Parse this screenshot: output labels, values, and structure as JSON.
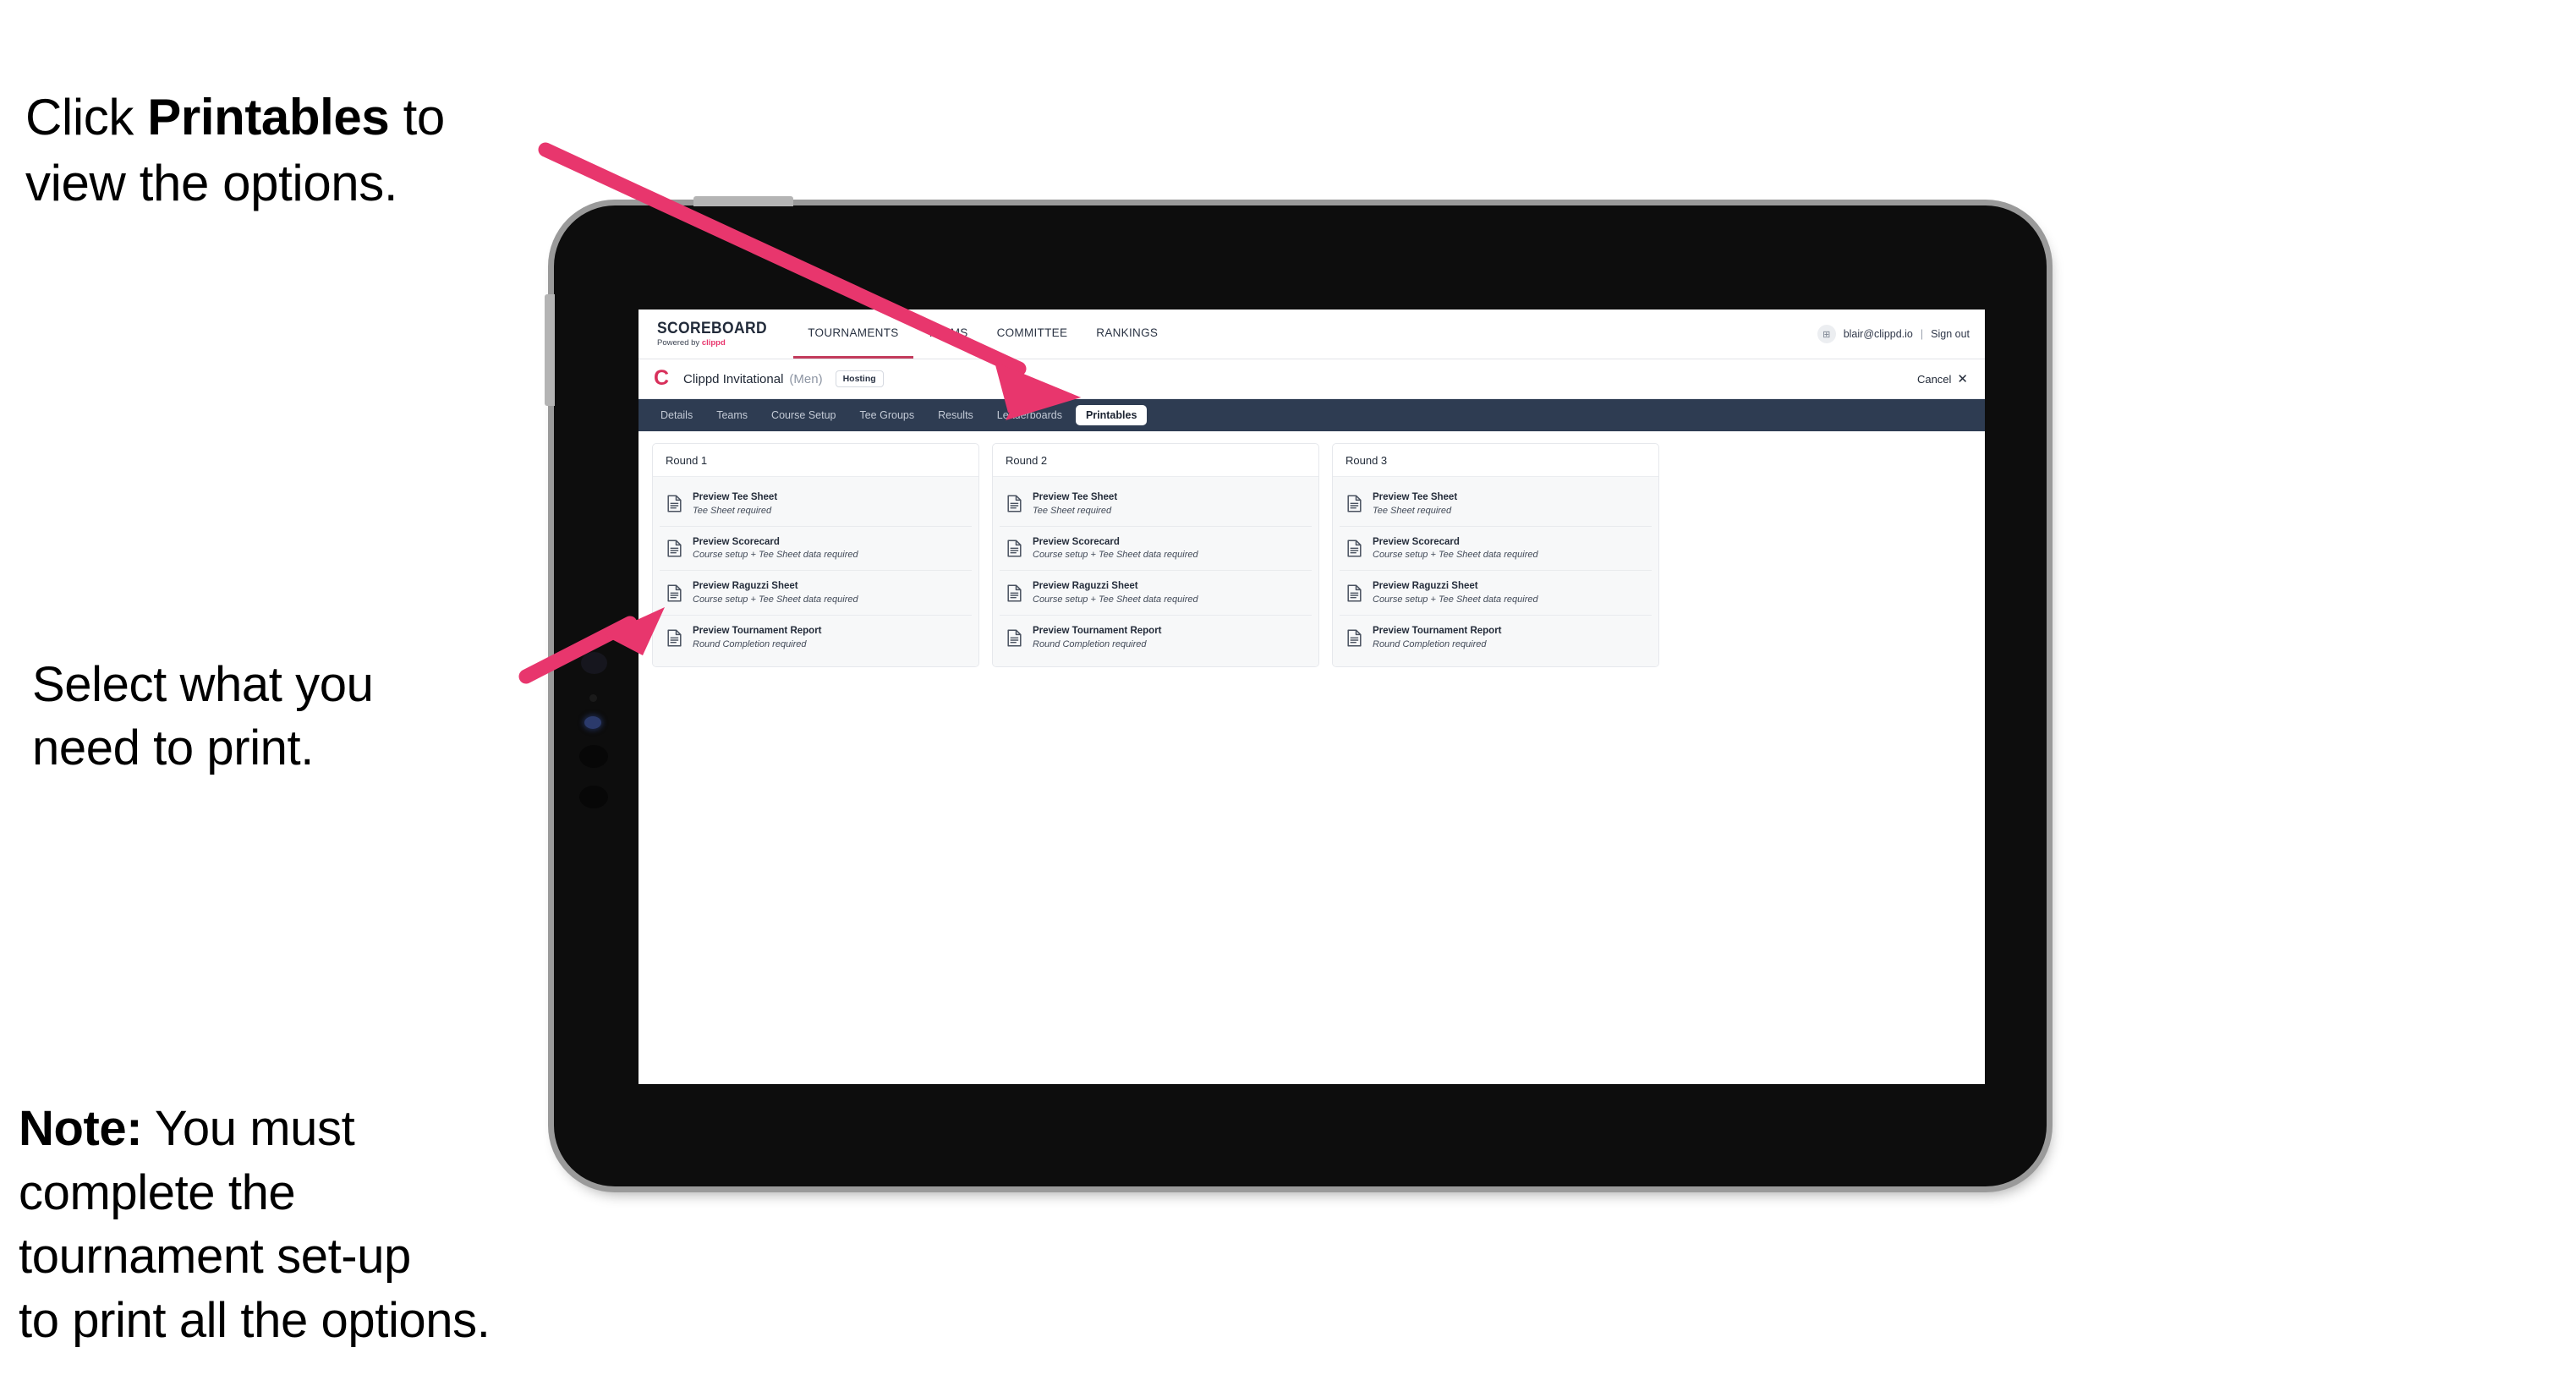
{
  "annotations": {
    "click_printables": "Click Printables to\nview the options.",
    "click_printables_pre": "Click ",
    "click_printables_bold": "Printables",
    "click_printables_post": " to\nview the options.",
    "select_print": "Select what you\n need to print.",
    "note_label": "Note:",
    "note_body": " You must\ncomplete the\ntournament set-up\nto print all the options.",
    "arrow_color": "#e8366d"
  },
  "app": {
    "brand": {
      "title": "SCOREBOARD",
      "powered_prefix": "Powered by ",
      "powered_brand": "clippd"
    },
    "topnav": [
      {
        "label": "TOURNAMENTS",
        "active": true
      },
      {
        "label": "TEAMS",
        "active": false
      },
      {
        "label": "COMMITTEE",
        "active": false
      },
      {
        "label": "RANKINGS",
        "active": false
      }
    ],
    "account": {
      "avatar_glyph": "⊞",
      "email": "blair@clippd.io",
      "separator": "|",
      "sign_out": "Sign out"
    },
    "tournament": {
      "logo_glyph": "C",
      "name": "Clippd Invitational",
      "gender": "(Men)",
      "status": "Hosting",
      "cancel_label": "Cancel",
      "cancel_icon": "✕"
    },
    "tabs": [
      {
        "label": "Details",
        "active": false
      },
      {
        "label": "Teams",
        "active": false
      },
      {
        "label": "Course Setup",
        "active": false
      },
      {
        "label": "Tee Groups",
        "active": false
      },
      {
        "label": "Results",
        "active": false
      },
      {
        "label": "Leaderboards",
        "active": false
      },
      {
        "label": "Printables",
        "active": true
      }
    ],
    "rounds": [
      {
        "title": "Round 1",
        "items": [
          {
            "title": "Preview Tee Sheet",
            "requirement": "Tee Sheet required"
          },
          {
            "title": "Preview Scorecard",
            "requirement": "Course setup + Tee Sheet data required"
          },
          {
            "title": "Preview Raguzzi Sheet",
            "requirement": "Course setup + Tee Sheet data required"
          },
          {
            "title": "Preview Tournament Report",
            "requirement": "Round Completion required"
          }
        ]
      },
      {
        "title": "Round 2",
        "items": [
          {
            "title": "Preview Tee Sheet",
            "requirement": "Tee Sheet required"
          },
          {
            "title": "Preview Scorecard",
            "requirement": "Course setup + Tee Sheet data required"
          },
          {
            "title": "Preview Raguzzi Sheet",
            "requirement": "Course setup + Tee Sheet data required"
          },
          {
            "title": "Preview Tournament Report",
            "requirement": "Round Completion required"
          }
        ]
      },
      {
        "title": "Round 3",
        "items": [
          {
            "title": "Preview Tee Sheet",
            "requirement": "Tee Sheet required"
          },
          {
            "title": "Preview Scorecard",
            "requirement": "Course setup + Tee Sheet data required"
          },
          {
            "title": "Preview Raguzzi Sheet",
            "requirement": "Course setup + Tee Sheet data required"
          },
          {
            "title": "Preview Tournament Report",
            "requirement": "Round Completion required"
          }
        ]
      }
    ]
  },
  "colors": {
    "tabbar_bg": "#2e3c52",
    "accent_pink": "#e8366d",
    "brand_red": "#c33b5c",
    "tablet_body": "#0d0d0d"
  }
}
